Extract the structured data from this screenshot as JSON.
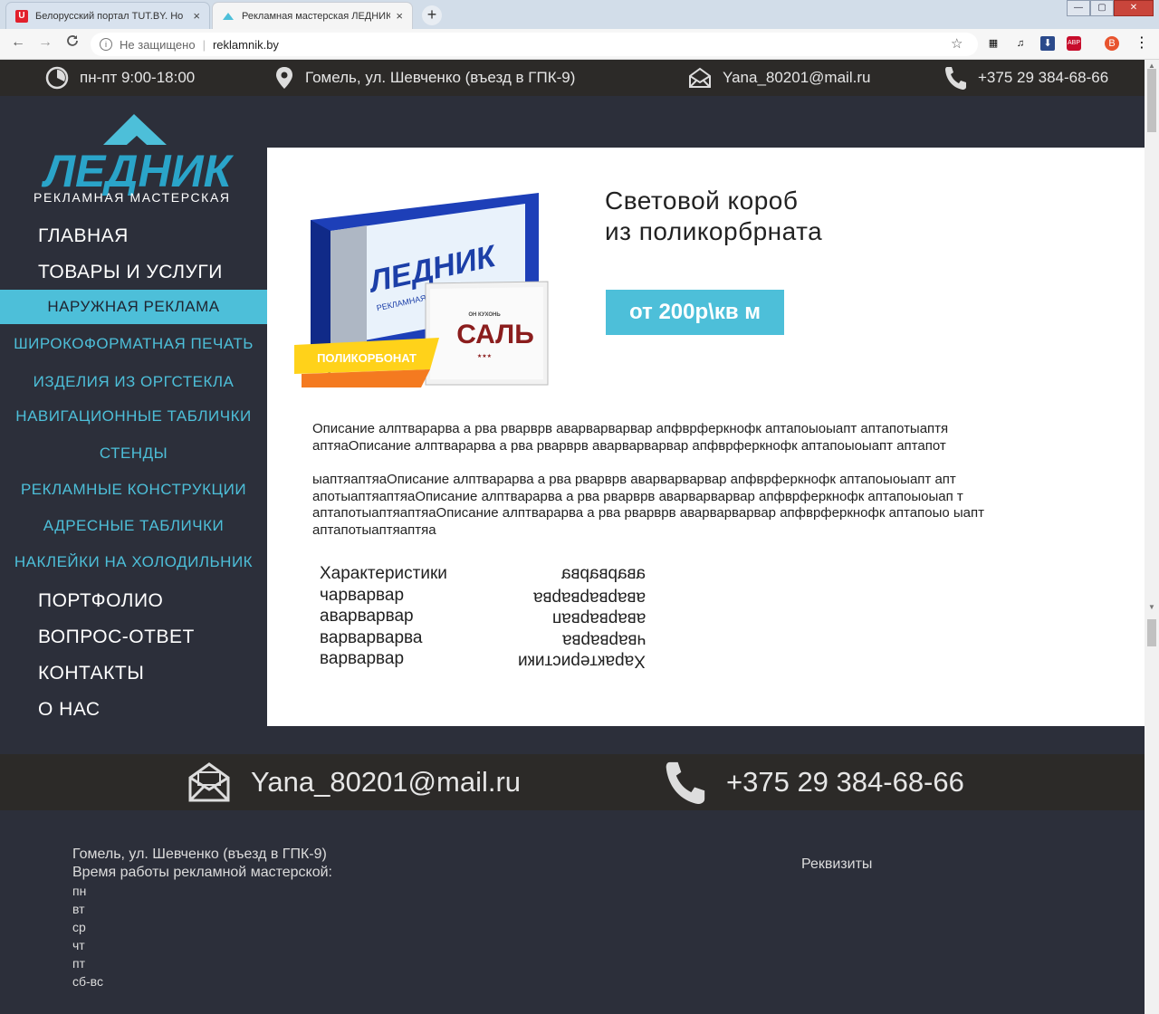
{
  "browser": {
    "tabs": [
      {
        "title": "Белорусский портал TUT.BY. Но",
        "close": "×",
        "favicon": "tutby-icon"
      },
      {
        "title": "Рекламная мастерская ЛЕДНИК",
        "close": "×",
        "favicon": "lednik-icon"
      }
    ],
    "new_tab": "+",
    "back": "←",
    "forward": "→",
    "reload": "C",
    "security_label": "Не защищено",
    "url": "reklamnik.by",
    "star": "☆",
    "window_controls": {
      "minimize": "—",
      "maximize": "▢",
      "close": "✕"
    },
    "extensions": [
      {
        "name": "grid-icon",
        "glyph": "▦",
        "color": "#4285f4"
      },
      {
        "name": "music-icon",
        "glyph": "♫",
        "color": "#444"
      },
      {
        "name": "download-icon",
        "glyph": "⬇",
        "color": "#2b4a8b"
      },
      {
        "name": "abp-icon",
        "glyph": "ABP",
        "color": "#c70d2c"
      },
      {
        "name": "profile-icon",
        "glyph": "В",
        "color": "#e8542e"
      },
      {
        "name": "menu-icon",
        "glyph": "⋮",
        "color": "#555"
      }
    ]
  },
  "topbar": {
    "hours": "пн-пт 9:00-18:00",
    "address": "Гомель, ул. Шевченко (въезд в ГПК-9)",
    "email": "Yana_80201@mail.ru",
    "phone": "+375 29 384-68-66"
  },
  "logo": {
    "name": "ЛЕДНИК",
    "subtitle": "РЕКЛАМНАЯ МАСТЕРСКАЯ"
  },
  "menu": {
    "main_top": [
      "ГЛАВНАЯ",
      "ТОВАРЫ И УСЛУГИ"
    ],
    "active": "НАРУЖНАЯ РЕКЛАМА",
    "sub": [
      "ШИРОКОФОРМАТНАЯ ПЕЧАТЬ",
      "ИЗДЕЛИЯ ИЗ ОРГСТЕКЛА",
      "НАВИГАЦИОННЫЕ ТАБЛИЧКИ",
      "СТЕНДЫ",
      "РЕКЛАМНЫЕ КОНСТРУКЦИИ",
      "АДРЕСНЫЕ ТАБЛИЧКИ",
      "НАКЛЕЙКИ НА ХОЛОДИЛЬНИК"
    ],
    "main_bottom": [
      "ПОРТФОЛИО",
      "ВОПРОС-ОТВЕТ",
      "КОНТАКТЫ",
      "О НАС"
    ]
  },
  "product": {
    "title_line1": "Световой короб",
    "title_line2": "из поликорбрната",
    "price": "от 200р\\кв м",
    "image_labels": {
      "brand": "ЛЕДНИК",
      "brand_sub": "РЕКЛАМНАЯ МАСТЕРСКАЯ",
      "badge": "ПОЛИКОРБОНАТ",
      "sign_top": "ОН КУХОНЬ",
      "sign_main": "САЛЬ",
      "sign_stars": "★★★"
    },
    "description": [
      "Описание алптварарва а рва рварврв  аварварварвар апфврферкнофк аптапоыоыапт аптапотыаптя аптяаОписание алптварарва а рва рварврв  аварварварвар апфврферкнофк аптапоыоыапт аптапот",
      "ыаптяаптяаОписание алптварарва а рва рварврв  аварварварвар апфврферкнофк аптапоыоыапт апт апотыаптяаптяаОписание алптварарва а рва рварврв  аварварварвар апфврферкнофк аптапоыоыап т аптапотыаптяаптяаОписание алптварарва а рва рварврв  аварварварвар апфврферкнофк аптапоыо ыапт аптапотыаптяаптяа"
    ],
    "specs": [
      {
        "label": "Характеристики",
        "value": "аварварва"
      },
      {
        "label": "чарварвар",
        "value": "аварварварва"
      },
      {
        "label": "аварварвар",
        "value": "аварварвап"
      },
      {
        "label": "варварварва",
        "value": "чварварва"
      },
      {
        "label": "варварвар",
        "value": "Характеристики"
      }
    ]
  },
  "contactbar": {
    "email": "Yana_80201@mail.ru",
    "phone": "+375 29 384-68-66"
  },
  "footer": {
    "address": "Гомель, ул. Шевченко (въезд в ГПК-9)",
    "hours_title": "Время работы рекламной мастерской:",
    "days": [
      "пн",
      "вт",
      "ср",
      "чт",
      "пт",
      "сб-вс"
    ],
    "requisites": "Реквизиты"
  },
  "colors": {
    "accent": "#4dbfd9",
    "dark_bg": "#2c2f3a",
    "bar_bg": "#2c2a28"
  }
}
